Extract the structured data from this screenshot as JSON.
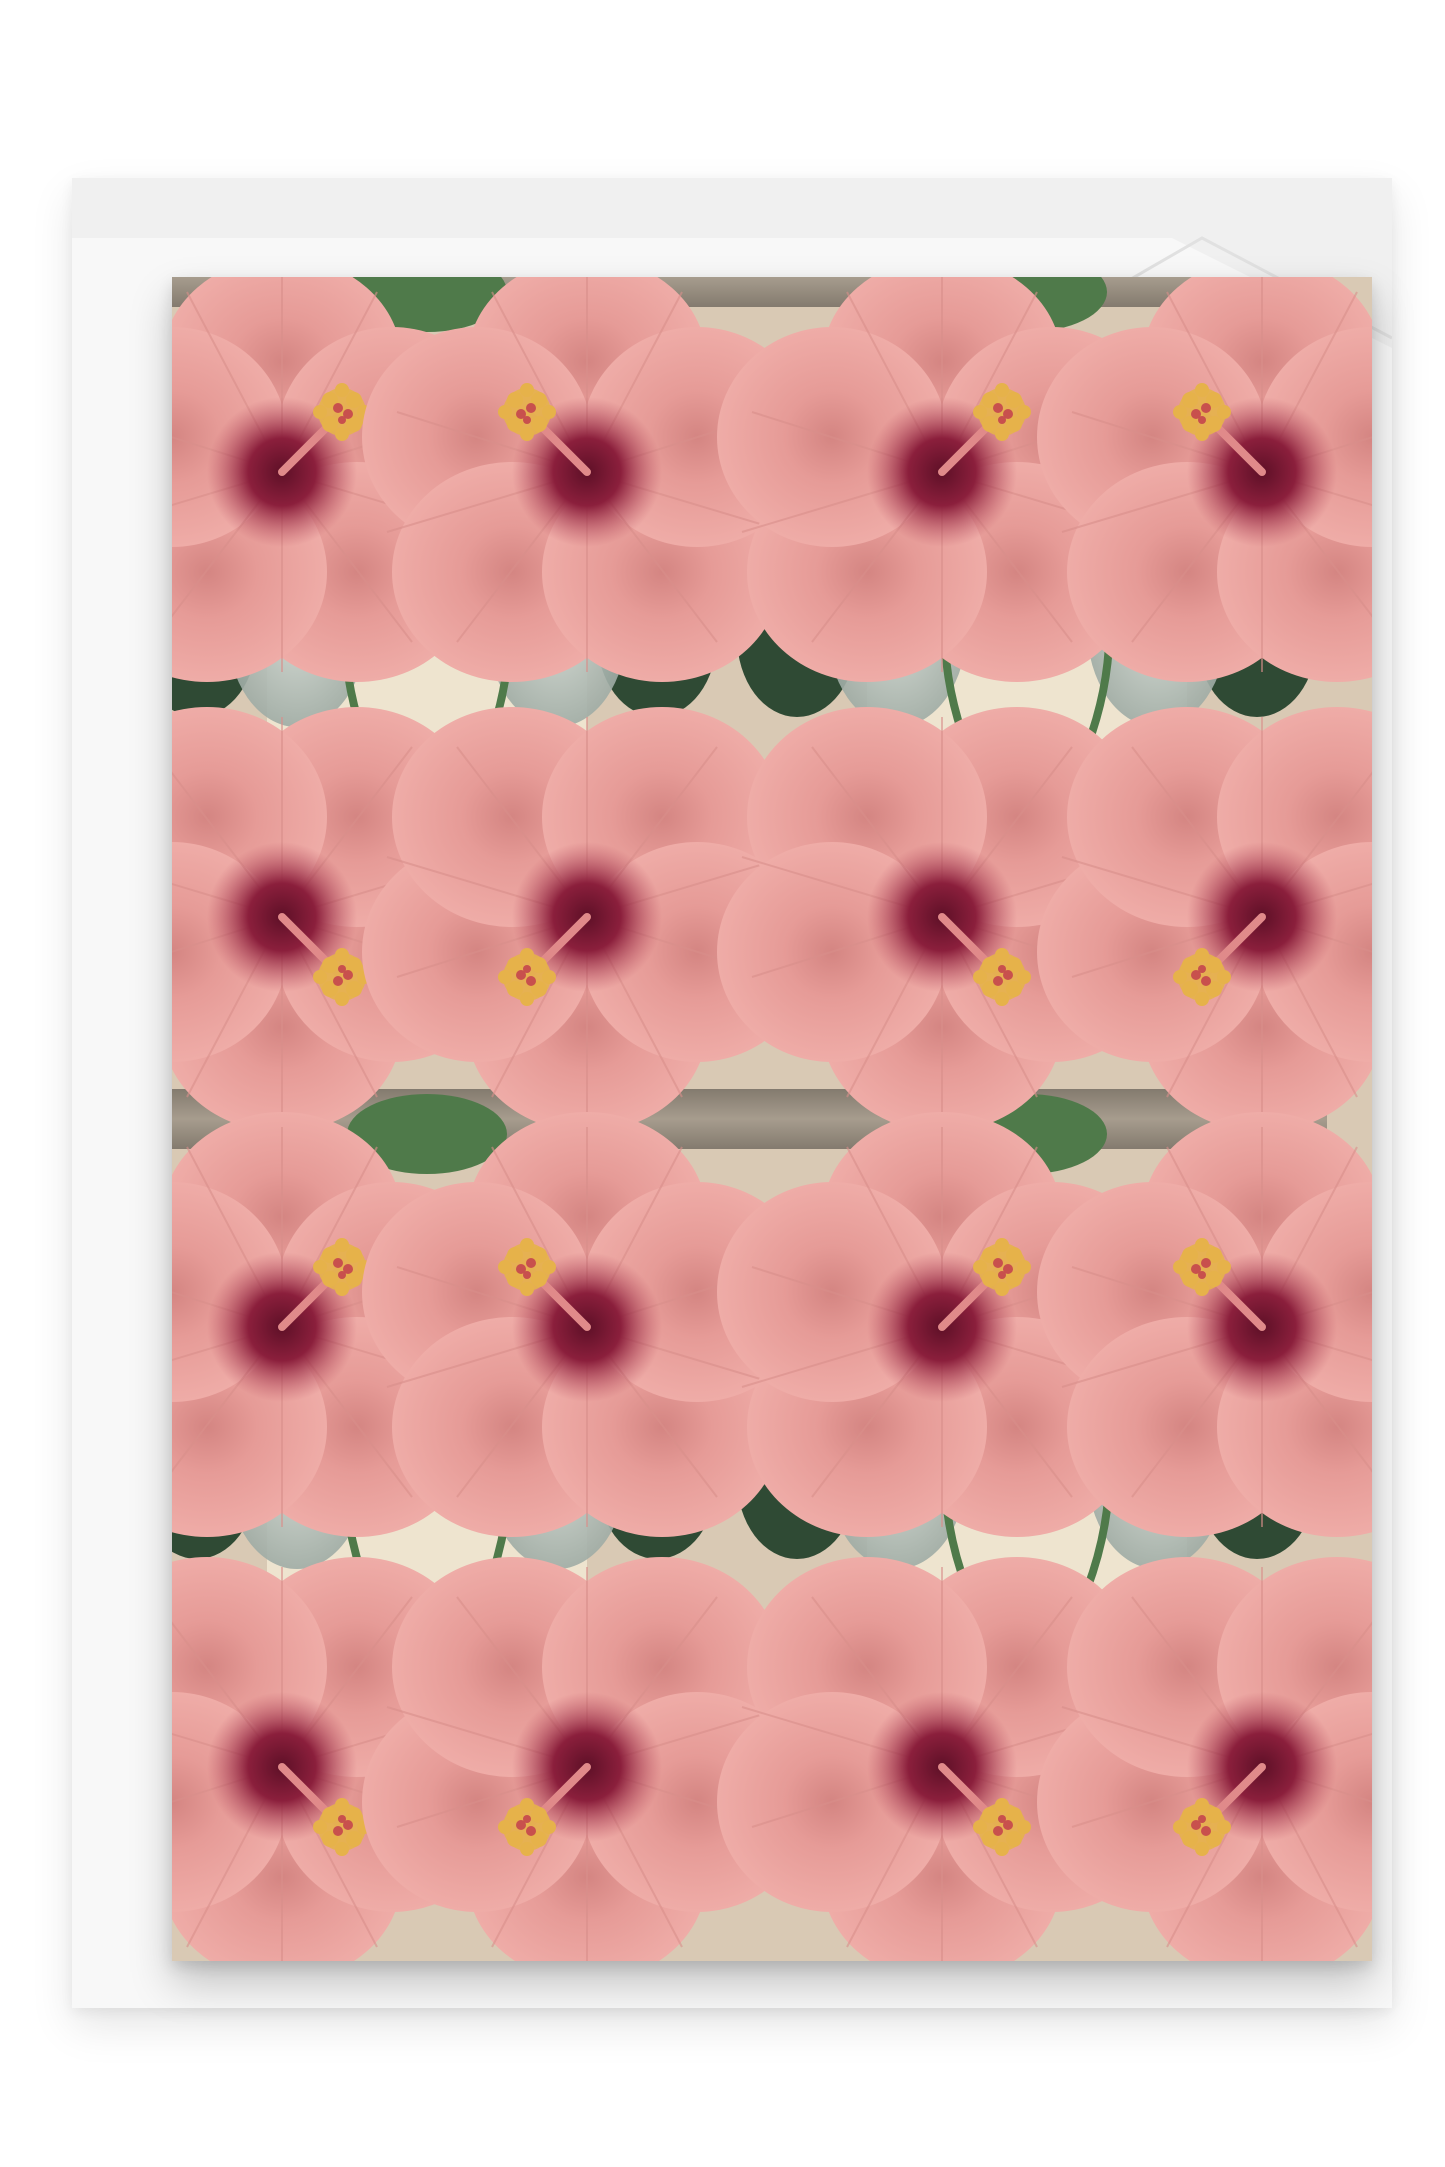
{
  "scene": {
    "subject": "greeting-card-on-envelope",
    "envelope_color": "#f8f8f8",
    "card_background": "#d9c9b4"
  },
  "pattern": {
    "motif": "hibiscus-mirror-tile",
    "columns": 4,
    "rows": 4,
    "colors": {
      "petal_light": "#f2b2ad",
      "petal_mid": "#e69b97",
      "petal_dark": "#d48582",
      "throat": "#8b1f3c",
      "throat_outer": "#b64a5c",
      "stamen": "#e6b24a",
      "leaf": "#4f7a4a",
      "leaf_dark": "#2f4a34",
      "stone": "#8a8173",
      "cream": "#eee4cf",
      "glass": "#b7c1bd"
    }
  }
}
